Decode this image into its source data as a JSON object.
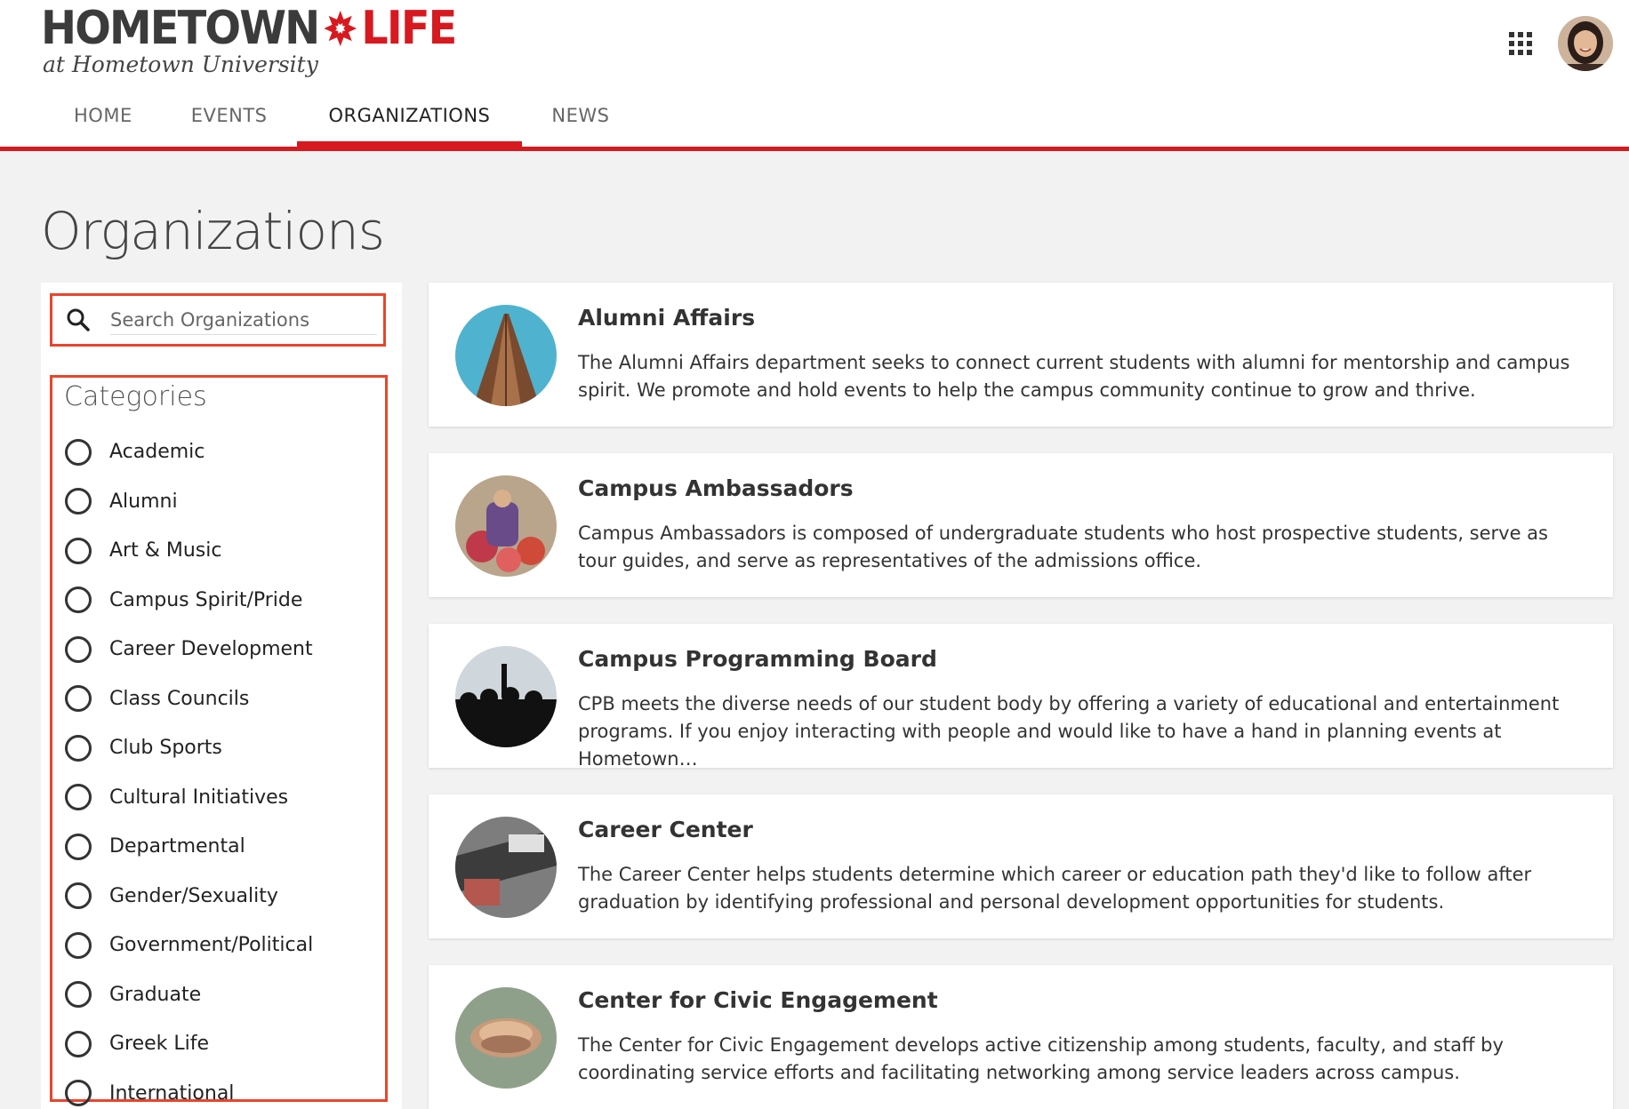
{
  "header": {
    "logo_left": "HOMETOWN",
    "logo_right": "LIFE",
    "logo_sub": "at Hometown University",
    "nav": [
      "HOME",
      "EVENTS",
      "ORGANIZATIONS",
      "NEWS"
    ],
    "active_nav": "ORGANIZATIONS"
  },
  "page": {
    "title": "Organizations"
  },
  "search": {
    "placeholder": "Search Organizations",
    "value": ""
  },
  "categories": {
    "title": "Categories",
    "items": [
      "Academic",
      "Alumni",
      "Art & Music",
      "Campus Spirit/Pride",
      "Career Development",
      "Class Councils",
      "Club Sports",
      "Cultural Initiatives",
      "Departmental",
      "Gender/Sexuality",
      "Government/Political",
      "Graduate",
      "Greek Life",
      "International"
    ]
  },
  "organizations": [
    {
      "name": "Alumni Affairs",
      "description": "The Alumni Affairs department seeks to connect current students with alumni for mentorship and campus spirit. We promote and hold events to help the campus community continue to grow and thrive."
    },
    {
      "name": "Campus Ambassadors",
      "description": "Campus Ambassadors is composed of undergraduate students who host prospective students, serve as tour guides, and serve as representatives of the admissions office."
    },
    {
      "name": "Campus Programming Board",
      "description": "CPB meets the diverse needs of our student body by offering a variety of educational and entertainment programs. If you enjoy interacting with people and would like to have a hand in planning events at Hometown…"
    },
    {
      "name": "Career Center",
      "description": "The Career Center helps students determine which career or education path they'd like to follow after graduation by identifying professional and personal development opportunities for students."
    },
    {
      "name": "Center for Civic Engagement",
      "description": "The Center for Civic Engagement develops active citizenship among students, faculty, and staff by coordinating service efforts and facilitating networking among service leaders across campus."
    }
  ],
  "colors": {
    "brand_red": "#d71920",
    "highlight": "#e8452c"
  }
}
